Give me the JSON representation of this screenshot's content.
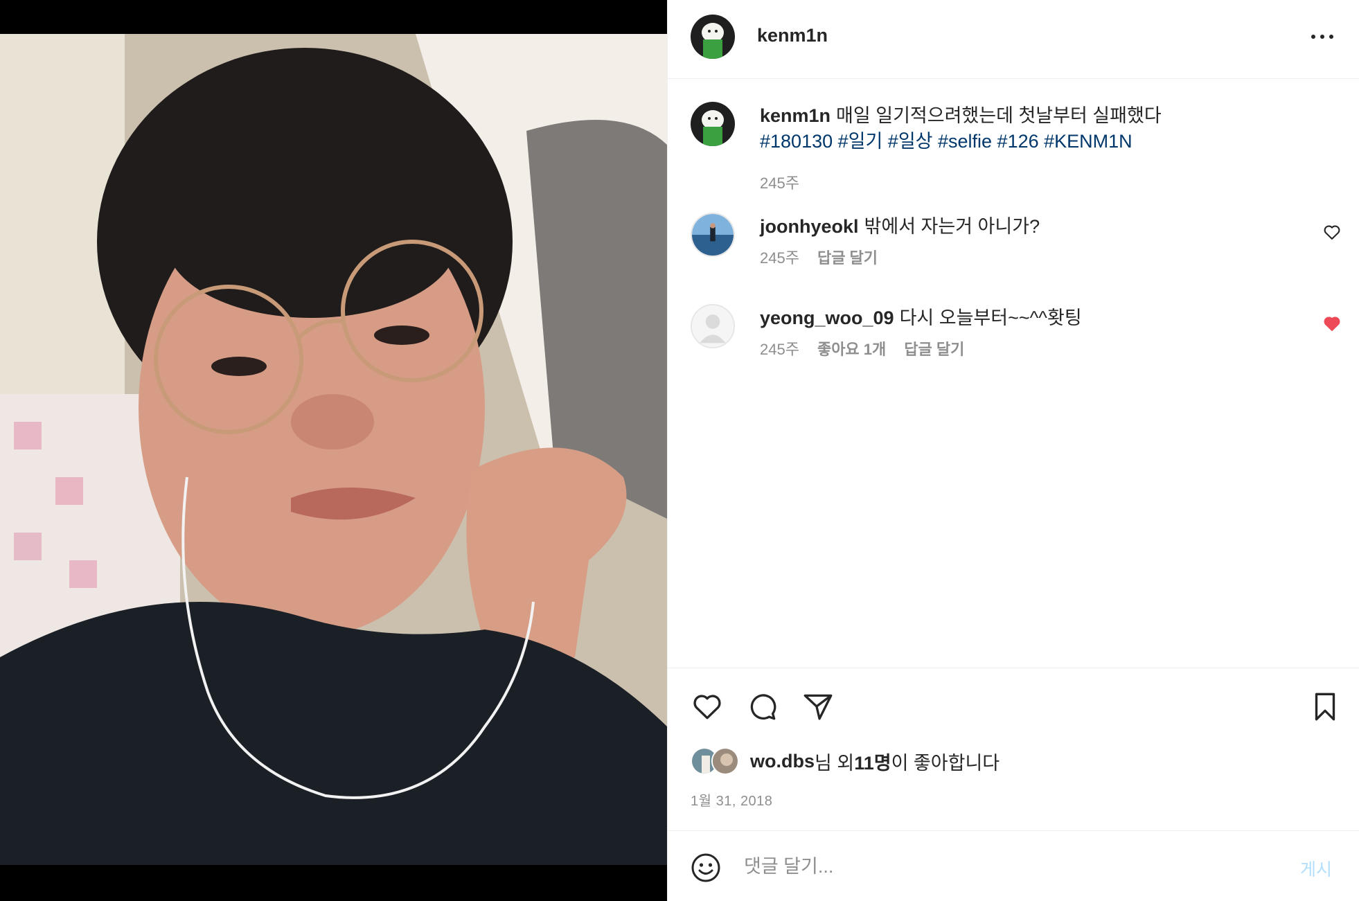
{
  "post": {
    "author": "kenm1n",
    "caption": "매일 일기적으려했는데 첫날부터 실패했다",
    "hashtags": "#180130 #일기 #일상 #selfie #126 #KENM1N",
    "caption_age": "245주",
    "likes_user": "wo.dbs",
    "likes_suffix_1": "님 외 ",
    "likes_count": "11명",
    "likes_suffix_2": "이 좋아합니다",
    "date": "1월 31, 2018"
  },
  "comments": [
    {
      "user": "joonhyeokl",
      "text": "밖에서 자는거 아니가?",
      "age": "245주",
      "reply_label": "답글 달기",
      "liked": false
    },
    {
      "user": "yeong_woo_09",
      "text": "다시 오늘부터~~^^홧팅",
      "age": "245주",
      "like_count": "좋아요 1개",
      "reply_label": "답글 달기",
      "liked": true
    }
  ],
  "composer": {
    "placeholder": "댓글 달기...",
    "post_label": "게시"
  },
  "colors": {
    "hashtag": "#00376b",
    "liked_heart": "#ed4956",
    "muted_text": "#8e8e8e",
    "post_button_disabled": "#b2dffc"
  },
  "icons": [
    "more-icon",
    "heart-icon",
    "comment-icon",
    "share-icon",
    "bookmark-icon",
    "emoji-icon"
  ]
}
